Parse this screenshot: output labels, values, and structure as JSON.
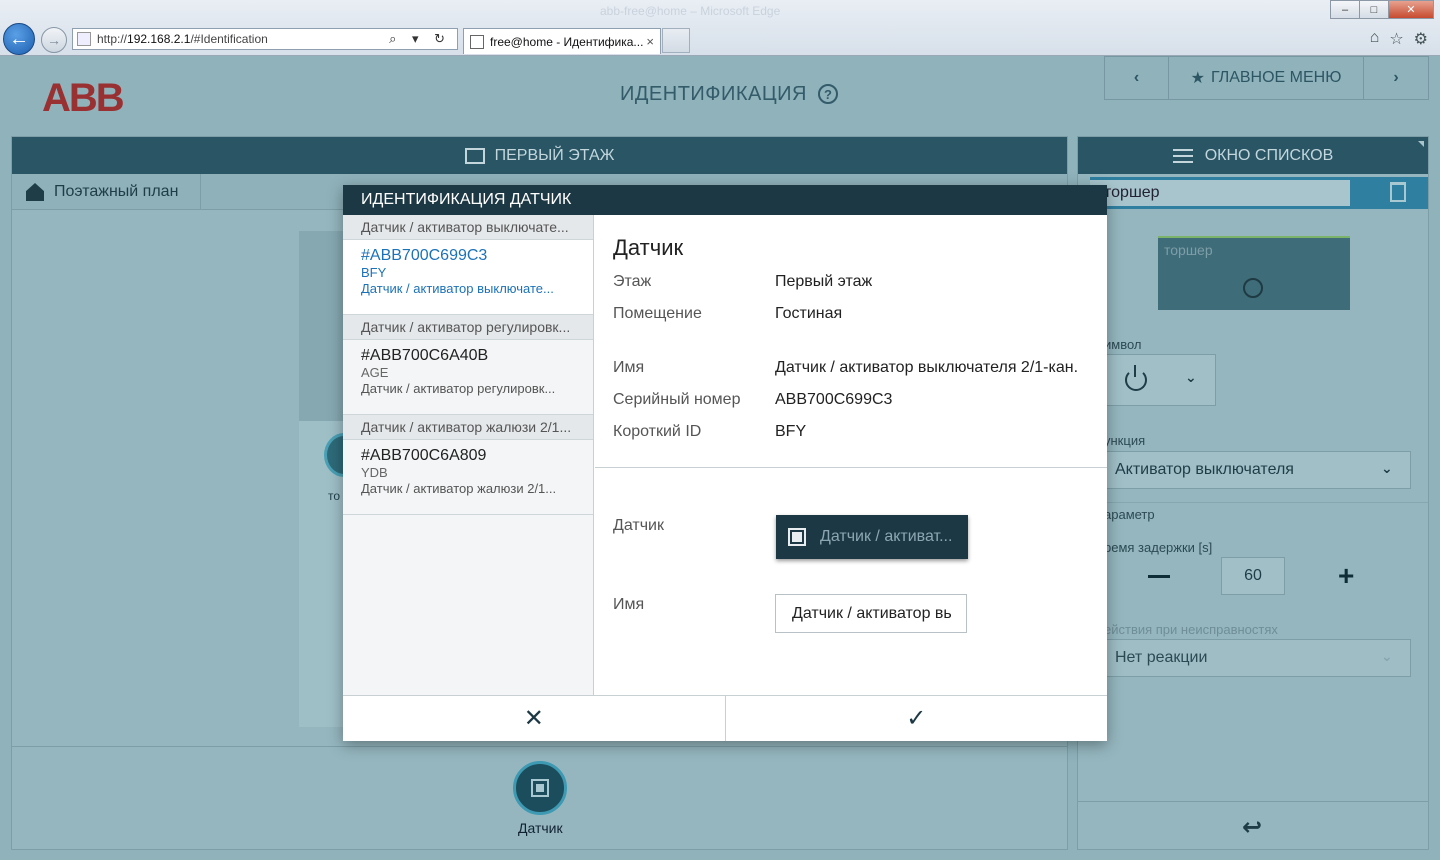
{
  "browser": {
    "window_title": "abb-free@home – Microsoft Edge",
    "url_prefix": "http://",
    "url_host": "192.168.2.1",
    "url_path": "/#Identification",
    "tab_title": "free@home - Идентифика...",
    "address_tools": "⌕ ▾ ↻",
    "tab_close": "×",
    "window_controls": {
      "minimize": "–",
      "maximize": "□",
      "close": "✕"
    },
    "back_glyph": "←",
    "forward_glyph": "→",
    "icons": [
      "home-icon",
      "favorites-icon",
      "tools-icon"
    ],
    "icon_glyphs": {
      "home": "⌂",
      "favorites": "☆",
      "tools": "⚙"
    }
  },
  "header": {
    "logo": "ABB",
    "title": "ИДЕНТИФИКАЦИЯ",
    "help_glyph": "?",
    "nav_prev": "‹",
    "nav_main": "ГЛАВНОЕ МЕНЮ",
    "nav_main_icon": "★",
    "nav_next": "›"
  },
  "left_panel": {
    "floor_title": "ПЕРВЫЙ ЭТАЖ",
    "floorplan_label": "Поэтажный план",
    "ghost_label": "то",
    "sensor_label": "Датчик"
  },
  "right_panel": {
    "title": "ОКНО СПИСКОВ",
    "name_value": "торшер",
    "tile_label": "торшер",
    "symbol_label": "имвол",
    "function_label": "ункция",
    "function_value": "Активатор выключателя",
    "param_label": "араметр",
    "delay_label": "ремя задержки [s]",
    "delay_value": "60",
    "minus_glyph": "–",
    "plus_glyph": "+",
    "fault_label": "ействия при неисправностях",
    "fault_value": "Нет реакции",
    "chevron": "⌄",
    "back_glyph": "↩"
  },
  "modal": {
    "title": "ИДЕНТИФИКАЦИЯ ДАТЧИК",
    "groups": [
      {
        "head": "Датчик / активатор выключате...",
        "device": {
          "serial": "#ABB700C699C3",
          "short": "BFY",
          "type": "Датчик / активатор выключате..."
        }
      },
      {
        "head": "Датчик / активатор регулировк...",
        "device": {
          "serial": "#ABB700C6A40B",
          "short": "AGE",
          "type": "Датчик / активатор регулировк..."
        }
      },
      {
        "head": "Датчик / активатор жалюзи 2/1...",
        "device": {
          "serial": "#ABB700C6A809",
          "short": "YDB",
          "type": "Датчик / активатор жалюзи 2/1..."
        }
      }
    ],
    "detail": {
      "title": "Датчик",
      "floor_label": "Этаж",
      "floor_value": "Первый этаж",
      "room_label": "Помещение",
      "room_value": "Гостиная",
      "name_label": "Имя",
      "name_value": "Датчик / активатор выключателя 2/1-кан.",
      "serial_label": "Серийный номер",
      "serial_value": "ABB700C699C3",
      "short_label": "Короткий ID",
      "short_value": "BFY",
      "sensor_label": "Датчик",
      "sensor_button": "Датчик / активат...",
      "name_field_label": "Имя",
      "name_field_value": "Датчик / активатор вь"
    },
    "cancel_glyph": "✕",
    "confirm_glyph": "✓"
  },
  "colors": {
    "dark_header": "#1d3845",
    "panel_header": "#2a5565",
    "overlay_bg": "#8fb2bb",
    "selected_blue": "#1c72b8",
    "abb_red": "#9b1a1a"
  }
}
